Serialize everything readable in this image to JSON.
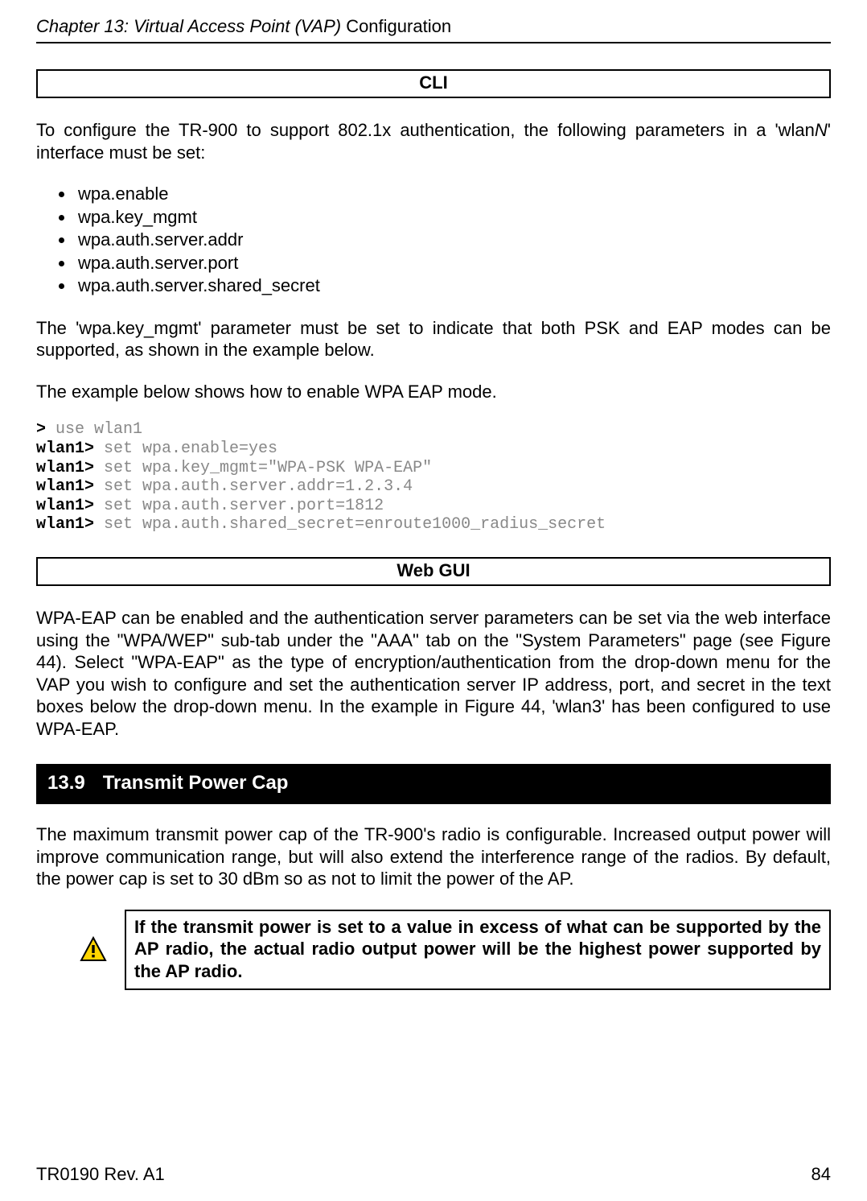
{
  "chapter": {
    "prefix": "Chapter 13: Virtual Access Point (VAP) ",
    "suffix": "Configuration"
  },
  "cli_header": "CLI",
  "intro": {
    "part1": "To configure the TR-900 to support 802.1x authentication, the following parameters in a 'wlan",
    "ital": "N",
    "part2": "' interface must be set:"
  },
  "params": [
    "wpa.enable",
    "wpa.key_mgmt",
    "wpa.auth.server.addr",
    "wpa.auth.server.port",
    "wpa.auth.server.shared_secret"
  ],
  "para2": "The 'wpa.key_mgmt' parameter must be set to indicate that both PSK and EAP modes can be supported, as shown in the example below.",
  "para3": "The example below shows how to enable WPA EAP mode.",
  "code": {
    "gt": ">",
    "l1_cmd": " use wlan1",
    "wlan": "wlan1>",
    "l2": " set wpa.enable=yes",
    "l3": " set wpa.key_mgmt=\"WPA-PSK WPA-EAP\"",
    "l4": " set wpa.auth.server.addr=1.2.3.4",
    "l5": " set wpa.auth.server.port=1812",
    "l6": " set wpa.auth.shared_secret=enroute1000_radius_secret"
  },
  "webgui_header": "Web GUI",
  "para4": "WPA-EAP can be enabled and the authentication server parameters can be set via the web interface using the \"WPA/WEP\" sub-tab under the \"AAA\" tab on the \"System Parameters\" page (see Figure 44). Select \"WPA-EAP\" as the type of encryption/authentication from the drop-down menu for the VAP you wish to configure and set the authentication server IP address, port, and secret in the text boxes below the drop-down menu. In the example in Figure 44, 'wlan3' has been configured to use WPA-EAP.",
  "section": {
    "number": "13.9",
    "title": "Transmit Power Cap"
  },
  "para5": "The maximum transmit power cap of the TR-900's radio is configurable. Increased output power will improve communication range, but will also extend the interference range of the radios. By default, the power cap is set to 30 dBm so as not to limit the power of the AP.",
  "callout": " If the transmit power is set to a value in excess of what can be supported by the AP radio, the actual radio output power will be the highest power supported by the AP radio.",
  "footer": {
    "left": "TR0190 Rev. A1",
    "right": "84"
  }
}
